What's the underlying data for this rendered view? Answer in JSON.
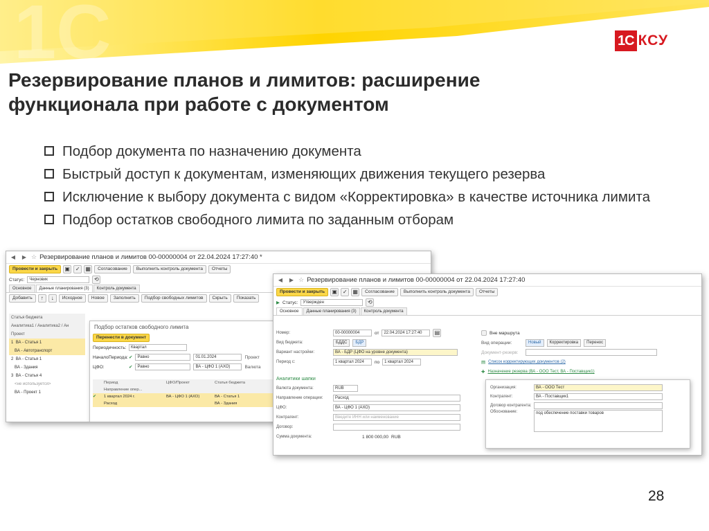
{
  "slide": {
    "title_line1": "Резервирование планов и лимитов: расширение",
    "title_line2": "функционала при работе с документом",
    "bullets": [
      "Подбор документа по назначению документа",
      "Быстрый доступ к документам, изменяющих движения текущего резерва",
      "Исключение к выбору документа с видом «Корректировка» в качестве источника лимита",
      "Подбор остатков свободного лимита по заданным отборам"
    ],
    "page_number": "28",
    "brand_1c": "1С",
    "brand_ksu": "КСУ",
    "accent_color": "#ffd400",
    "brand_red": "#d71920"
  },
  "window1": {
    "title": "Резервирование планов и лимитов 00-00000004 от 22.04.2024 17:27:40 *",
    "toolbar": {
      "post_close": "Провести и закрыть",
      "approval": "Согласование",
      "control": "Выполнить контроль документа",
      "reports": "Отчеты"
    },
    "status_label": "Статус:",
    "status_value": "Черновик",
    "tabs": [
      "Основное",
      "Данные планирования (3)",
      "Контроль документа"
    ],
    "subtoolbar": {
      "add": "Добавить",
      "source": "Исходное",
      "new": "Новое",
      "fill": "Заполнить",
      "pick_free": "Подбор свободных лимитов",
      "hide": "Скрыть",
      "show": "Показать"
    },
    "table": {
      "header": "Статья бюджета",
      "sub1": "Аналитика1 / Аналитика2 / Ан",
      "sub2": "Проект",
      "rows": [
        {
          "n": "1",
          "text": "ВА - Статья 1"
        },
        {
          "n": "",
          "text": "ВА - Автотранспорт"
        },
        {
          "n": "2",
          "text": "ВА - Статья 1"
        },
        {
          "n": "",
          "text": "ВА - Здания"
        },
        {
          "n": "3",
          "text": "ВА - Статья 4"
        },
        {
          "n": "",
          "text": "<не используется>"
        },
        {
          "n": "",
          "text": "ВА - Проект 1"
        }
      ]
    },
    "popup": {
      "title": "Подбор остатков свободного лимита",
      "transfer": "Перенести в документ",
      "periodicity_label": "Периодичность:",
      "periodicity_value": "Квартал",
      "period_start_label": "НачалоПериода:",
      "period_start_cond": "Равно",
      "period_start_value": "01.01.2024",
      "cfo_label": "ЦФО:",
      "cfo_cond": "Равно",
      "cfo_value": "ВА - ЦФО 1 (АХО)",
      "grid_head": [
        "Период",
        "ЦФО/Проект",
        "Статья бюджета"
      ],
      "grid_head2": "Направление опер...",
      "rows": [
        [
          "1 квартал 2024 г.",
          "ВА - ЦФО 1 (АХО)",
          "ВА - Статья 1"
        ],
        [
          "Расход",
          "",
          "ВА - Здания"
        ]
      ],
      "side_project": "Проект",
      "side_currency": "Валюта"
    }
  },
  "window2": {
    "title": "Резервирование планов и лимитов 00-00000004 от 22.04.2024 17:27:40",
    "toolbar": {
      "post_close": "Провести и закрыть",
      "approval": "Согласование",
      "control": "Выполнить контроль документа",
      "reports": "Отчеты"
    },
    "status_label": "Статус:",
    "status_value": "Утвержден",
    "tabs": [
      "Основное",
      "Данные планирования (3)",
      "Контроль документа"
    ],
    "form": {
      "number_label": "Номер:",
      "number_value": "00-00000004",
      "date_from": "от",
      "date_value": "22.04.2024 17:27:40",
      "budget_type_label": "Вид бюджета:",
      "bdds": "БДДС",
      "bdr": "БДР",
      "variant_label": "Вариант настройки:",
      "variant_value": "ВА - БДР (ЦФО на уровне документа)",
      "period_label": "Период с:",
      "period_from": "1 квартал 2024",
      "period_to_label": "по",
      "period_to": "1 квартал 2024",
      "out_of_route": "Вне маршрута",
      "operation_type_label": "Вид операции:",
      "op_new": "Новый",
      "op_correction": "Корректировка",
      "op_transfer": "Перенос",
      "reserve_doc_label": "Документ-резерв:",
      "link_corrections": "Список корректирующих документов (2)",
      "reserve_purpose": "Назначение резерва (ВА - ООО Тест, ВА - Поставщик1)",
      "header_analytics": "Аналитики шапки",
      "currency_label": "Валюта документа:",
      "currency_value": "RUB",
      "direction_label": "Направление операции:",
      "direction_value": "Расход",
      "cfo_label": "ЦФО:",
      "cfo_value": "ВА - ЦФО 1 (АХО)",
      "counterparty_label": "Контрагент:",
      "counterparty_placeholder": "Введите ИНН или наименование",
      "contract_label": "Договор:",
      "amount_label": "Сумма документа:",
      "amount_value": "1 800 000,00",
      "amount_currency": "RUB"
    },
    "popup": {
      "org_label": "Организация:",
      "org_value": "ВА - ООО Тест",
      "counterparty_label": "Контрагент:",
      "counterparty_value": "ВА - Поставщик1",
      "contract_label": "Договор контрагента:",
      "basis_label": "Обоснование:",
      "basis_value": "под обеспечение поставки товаров"
    }
  }
}
